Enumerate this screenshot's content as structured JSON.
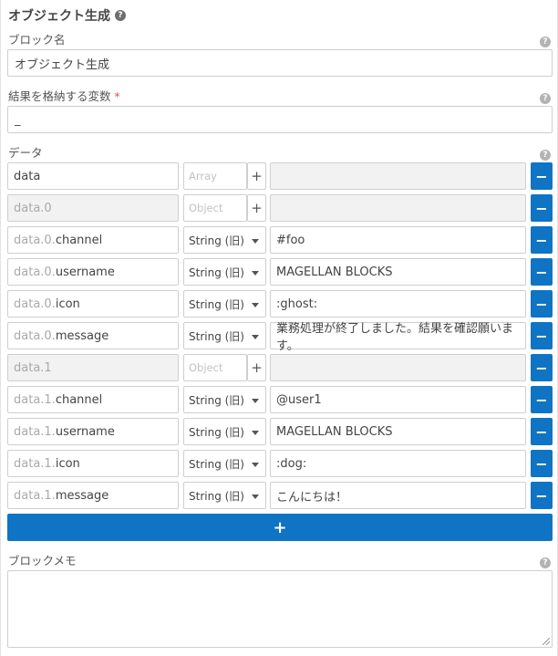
{
  "header": {
    "title": "オブジェクト生成",
    "help_glyph": "?"
  },
  "block_name": {
    "label": "ブロック名",
    "value": "オブジェクト生成"
  },
  "result_var": {
    "label": "結果を格納する変数",
    "required_mark": "*",
    "value": "_"
  },
  "data_section": {
    "label": "データ",
    "type_options_placeholder": {
      "array": "Array",
      "object": "Object"
    },
    "rows": [
      {
        "prefix": "",
        "key": "data",
        "type": "Array",
        "val": "",
        "kind": "array"
      },
      {
        "prefix": "",
        "key": "data.0",
        "type": "Object",
        "val": "",
        "kind": "object"
      },
      {
        "prefix": "data.0.",
        "key": "channel",
        "type": "String (旧)",
        "val": "#foo",
        "kind": "string"
      },
      {
        "prefix": "data.0.",
        "key": "username",
        "type": "String (旧)",
        "val": "MAGELLAN BLOCKS",
        "kind": "string"
      },
      {
        "prefix": "data.0.",
        "key": "icon",
        "type": "String (旧)",
        "val": ":ghost:",
        "kind": "string"
      },
      {
        "prefix": "data.0.",
        "key": "message",
        "type": "String (旧)",
        "val": "業務処理が終了しました。結果を確認願います。",
        "kind": "string"
      },
      {
        "prefix": "",
        "key": "data.1",
        "type": "Object",
        "val": "",
        "kind": "object"
      },
      {
        "prefix": "data.1.",
        "key": "channel",
        "type": "String (旧)",
        "val": "@user1",
        "kind": "string"
      },
      {
        "prefix": "data.1.",
        "key": "username",
        "type": "String (旧)",
        "val": "MAGELLAN BLOCKS",
        "kind": "string"
      },
      {
        "prefix": "data.1.",
        "key": "icon",
        "type": "String (旧)",
        "val": ":dog:",
        "kind": "string"
      },
      {
        "prefix": "data.1.",
        "key": "message",
        "type": "String (旧)",
        "val": "こんにちは！",
        "kind": "string"
      }
    ],
    "remove_glyph": "−",
    "inline_add_glyph": "+",
    "add_glyph": "+"
  },
  "memo": {
    "label": "ブロックメモ",
    "value": ""
  },
  "colors": {
    "accent": "#0f74c4",
    "required": "#d9534f",
    "disabled_bg": "#f2f2f2"
  }
}
